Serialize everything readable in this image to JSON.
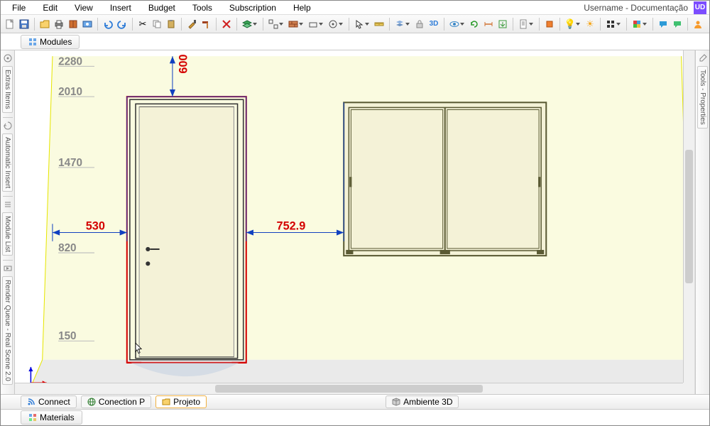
{
  "menus": [
    "File",
    "Edit",
    "View",
    "Insert",
    "Budget",
    "Tools",
    "Subscription",
    "Help"
  ],
  "header": {
    "user_text": "Username - Documentação",
    "badge": "UD"
  },
  "top_tab": {
    "label": "Modules"
  },
  "left_panels": [
    "Extras Items",
    "Automatic Insert",
    "Module List",
    "Render Queue - Real Scene 2.0"
  ],
  "right_panels": [
    "Tools - Properties"
  ],
  "bottom_tabs": {
    "connect": "Connect",
    "conection": "Conection P",
    "projeto": "Projeto",
    "ambiente": "Ambiente 3D"
  },
  "materials_tab": "Materials",
  "ruler_marks": {
    "y0": "2280",
    "y1": "2010",
    "y2": "1470",
    "y3": "820",
    "y4": "150"
  },
  "dimensions": {
    "d530": "530",
    "d600": "600",
    "d7529": "752.9"
  },
  "icon_colors": {
    "new": "#ffffff",
    "open": "#f9d26c",
    "print": "#6aa7e8",
    "undo": "#2d7bd7",
    "redo": "#2d7bd7",
    "cut": "#888",
    "copy": "#888",
    "paste": "#888",
    "brush": "#d8a038",
    "hammer": "#aa4d2b",
    "del": "#d02020",
    "layers": "#3aa655",
    "arrow": "#333",
    "eye": "#3a88c8",
    "d3": "#2d7bd7",
    "star": "#d8a038",
    "bulb": "#f5c518",
    "grid": "#555",
    "chat": "#2d9bd7",
    "user": "#f79a2b"
  }
}
